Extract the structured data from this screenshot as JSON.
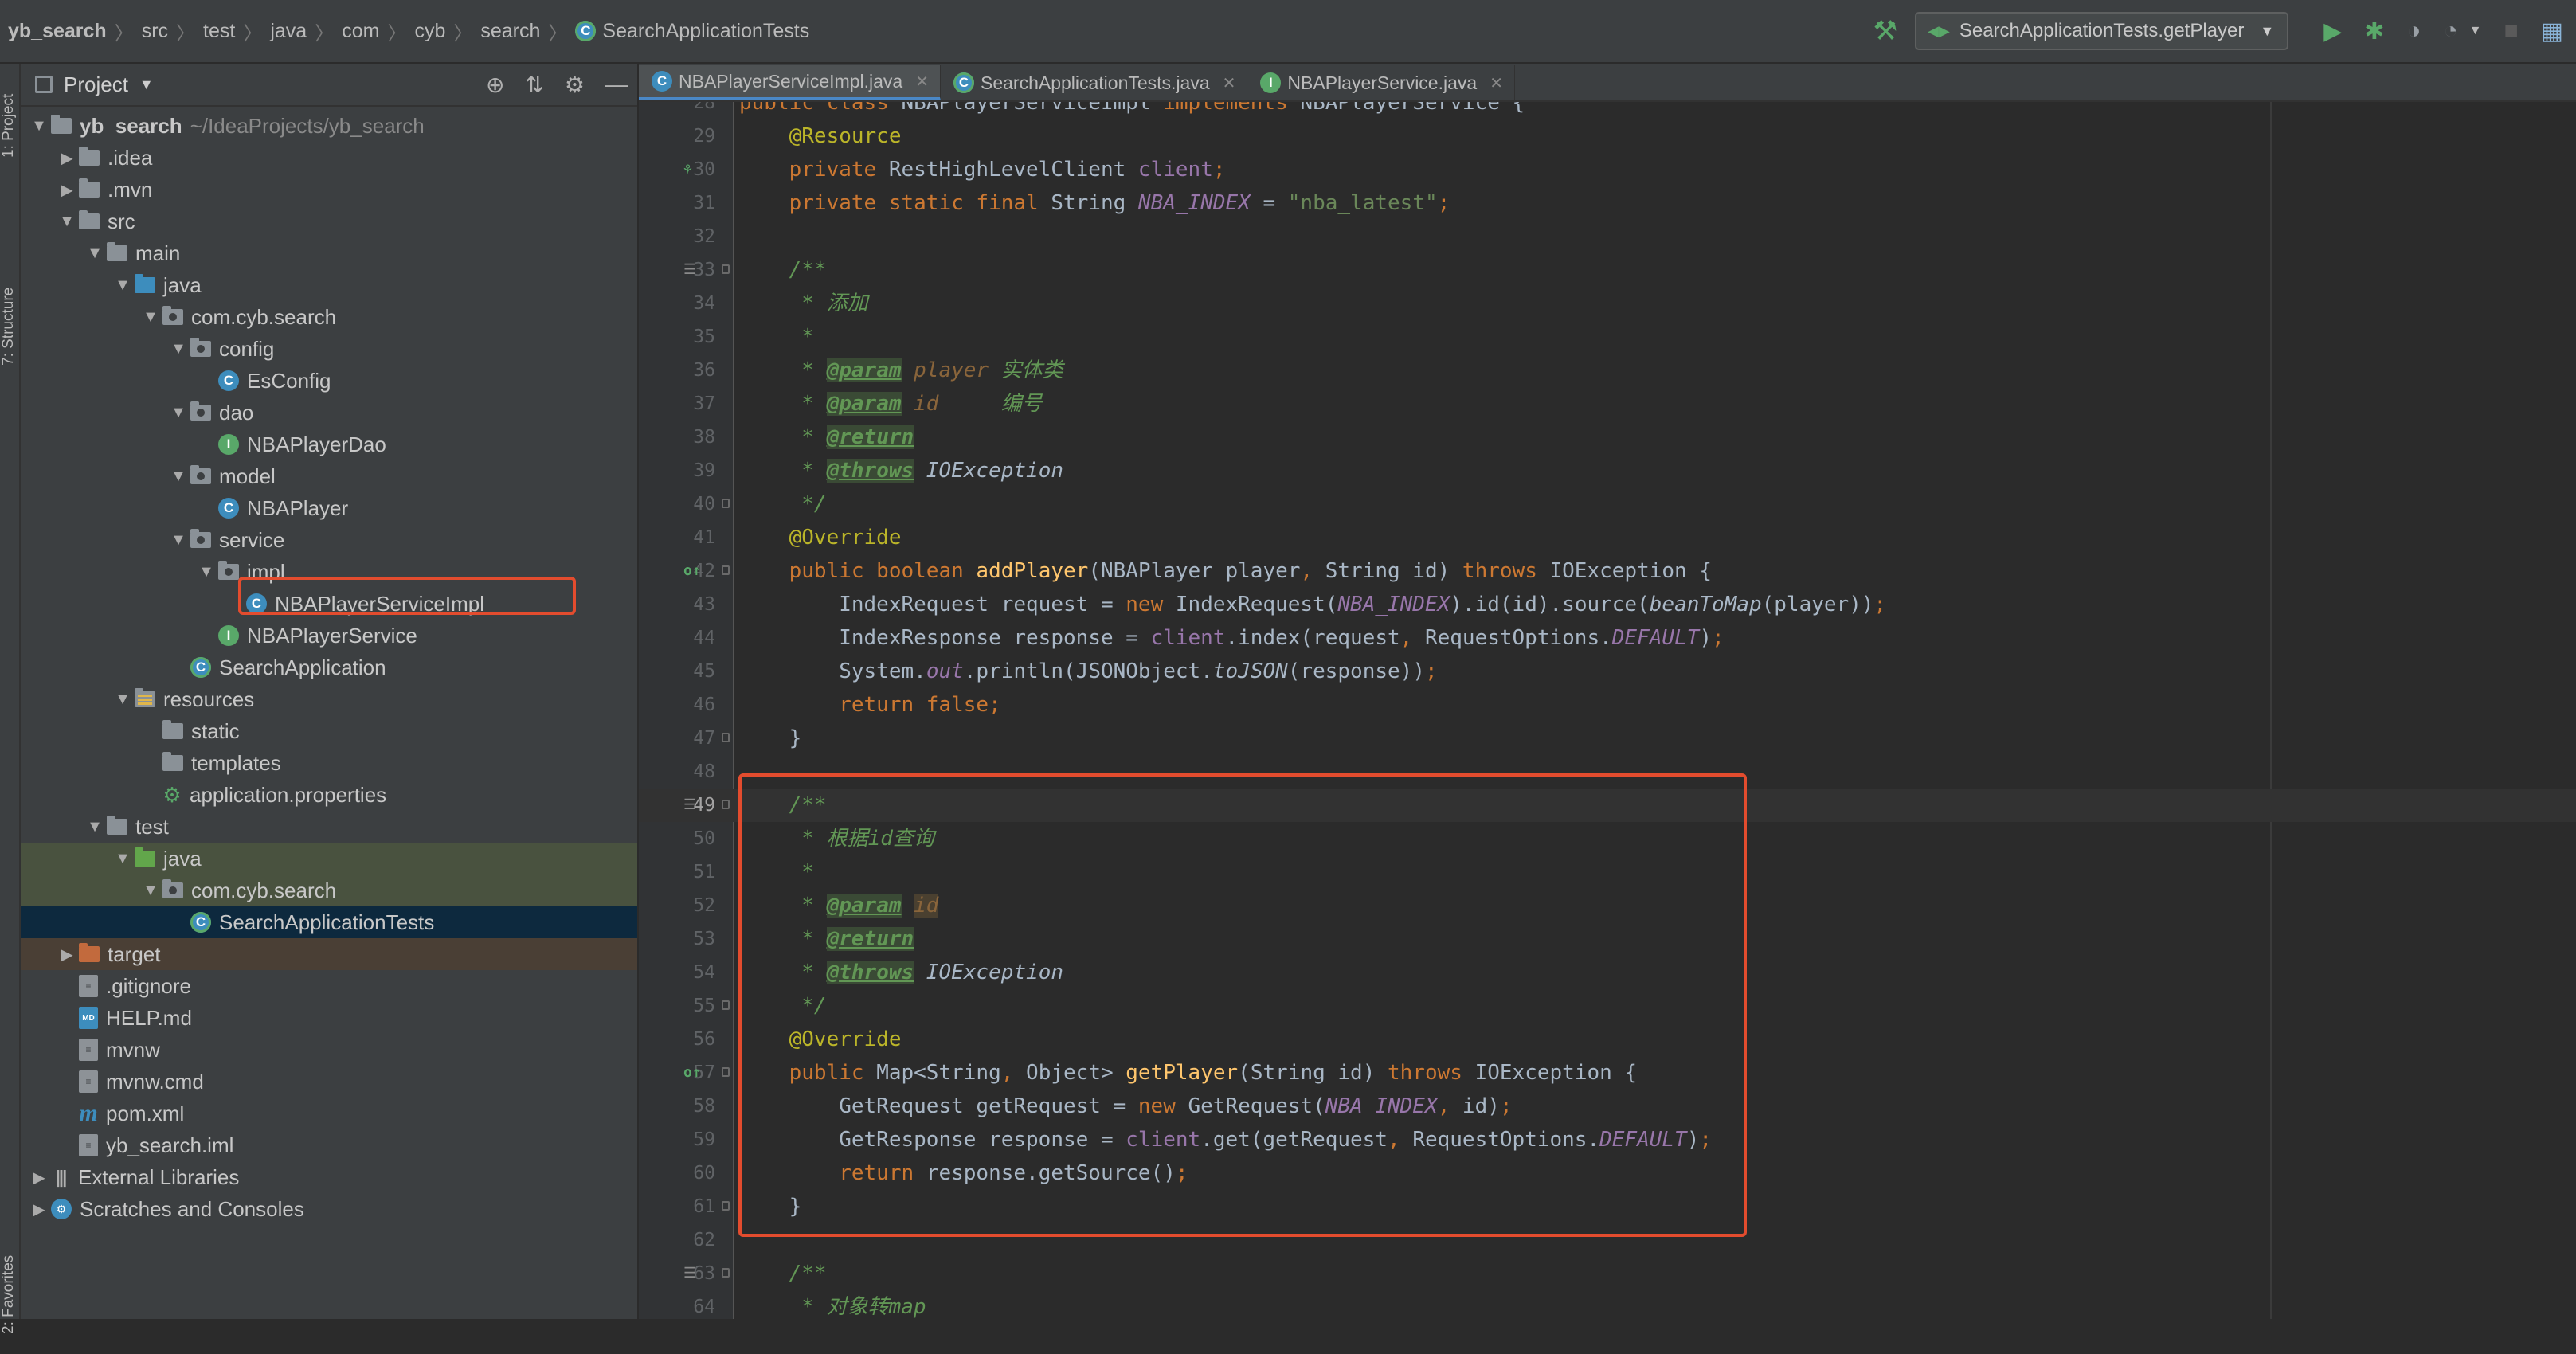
{
  "breadcrumbs": [
    "yb_search",
    "src",
    "test",
    "java",
    "com",
    "cyb",
    "search",
    "SearchApplicationTests"
  ],
  "run_config": "SearchApplicationTests.getPlayer",
  "icons": {
    "build": "hammer-icon",
    "run": "run-icon",
    "debug": "debug-icon",
    "coverage": "coverage-icon",
    "profile": "profile-icon",
    "stop": "stop-icon",
    "structure": "project-structure-icon"
  },
  "left_strip": {
    "project": "1: Project",
    "structure": "7: Structure",
    "favorites": "2: Favorites"
  },
  "project_panel": {
    "title": "Project",
    "tree": [
      {
        "label": "yb_search",
        "hint": "~/IdeaProjects/yb_search",
        "depth": 0,
        "arrow": "down",
        "icon": "folder"
      },
      {
        "label": ".idea",
        "depth": 1,
        "arrow": "right",
        "icon": "folder"
      },
      {
        "label": ".mvn",
        "depth": 1,
        "arrow": "right",
        "icon": "folder"
      },
      {
        "label": "src",
        "depth": 1,
        "arrow": "down",
        "icon": "folder"
      },
      {
        "label": "main",
        "depth": 2,
        "arrow": "down",
        "icon": "folder"
      },
      {
        "label": "java",
        "depth": 3,
        "arrow": "down",
        "icon": "folder-blue"
      },
      {
        "label": "com.cyb.search",
        "depth": 4,
        "arrow": "down",
        "icon": "package"
      },
      {
        "label": "config",
        "depth": 5,
        "arrow": "down",
        "icon": "package"
      },
      {
        "label": "EsConfig",
        "depth": 6,
        "icon": "class"
      },
      {
        "label": "dao",
        "depth": 5,
        "arrow": "down",
        "icon": "package"
      },
      {
        "label": "NBAPlayerDao",
        "depth": 6,
        "icon": "interface"
      },
      {
        "label": "model",
        "depth": 5,
        "arrow": "down",
        "icon": "package"
      },
      {
        "label": "NBAPlayer",
        "depth": 6,
        "icon": "class"
      },
      {
        "label": "service",
        "depth": 5,
        "arrow": "down",
        "icon": "package"
      },
      {
        "label": "impl",
        "depth": 6,
        "arrow": "down",
        "icon": "package"
      },
      {
        "label": "NBAPlayerServiceImpl",
        "depth": 7,
        "icon": "class",
        "highlight": true
      },
      {
        "label": "NBAPlayerService",
        "depth": 6,
        "icon": "interface"
      },
      {
        "label": "SearchApplication",
        "depth": 5,
        "icon": "springboot"
      },
      {
        "label": "resources",
        "depth": 3,
        "arrow": "down",
        "icon": "resources"
      },
      {
        "label": "static",
        "depth": 4,
        "icon": "folder"
      },
      {
        "label": "templates",
        "depth": 4,
        "icon": "folder"
      },
      {
        "label": "application.properties",
        "depth": 4,
        "icon": "properties"
      },
      {
        "label": "test",
        "depth": 2,
        "arrow": "down",
        "icon": "folder"
      },
      {
        "label": "java",
        "depth": 3,
        "arrow": "down",
        "icon": "folder-green",
        "bg": "test"
      },
      {
        "label": "com.cyb.search",
        "depth": 4,
        "arrow": "down",
        "icon": "package",
        "bg": "test"
      },
      {
        "label": "SearchApplicationTests",
        "depth": 5,
        "icon": "testclass",
        "bg": "selected"
      },
      {
        "label": "target",
        "depth": 1,
        "arrow": "right",
        "icon": "folder-orange",
        "bg": "excluded"
      },
      {
        "label": ".gitignore",
        "depth": 1,
        "icon": "file"
      },
      {
        "label": "HELP.md",
        "depth": 1,
        "icon": "md"
      },
      {
        "label": "mvnw",
        "depth": 1,
        "icon": "file"
      },
      {
        "label": "mvnw.cmd",
        "depth": 1,
        "icon": "file"
      },
      {
        "label": "pom.xml",
        "depth": 1,
        "icon": "maven"
      },
      {
        "label": "yb_search.iml",
        "depth": 1,
        "icon": "file"
      },
      {
        "label": "External Libraries",
        "depth": 0,
        "arrow": "right",
        "icon": "library"
      },
      {
        "label": "Scratches and Consoles",
        "depth": 0,
        "arrow": "right",
        "icon": "scratches"
      }
    ]
  },
  "tabs": [
    {
      "label": "NBAPlayerServiceImpl.java",
      "icon": "class",
      "active": true
    },
    {
      "label": "SearchApplicationTests.java",
      "icon": "testclass",
      "active": false
    },
    {
      "label": "NBAPlayerService.java",
      "icon": "interface",
      "active": false
    }
  ],
  "code_lines": [
    {
      "n": "28",
      "tokens": [
        [
          "kw",
          "public class "
        ],
        [
          "",
          "NBAPlayerServiceImpl "
        ],
        [
          "kw",
          "implements "
        ],
        [
          "",
          "NBAPlayerService {"
        ]
      ]
    },
    {
      "n": "29",
      "tokens": [
        [
          "ann",
          "    @Resource"
        ]
      ]
    },
    {
      "n": "30",
      "g": "bean",
      "tokens": [
        [
          "kw",
          "    private "
        ],
        [
          "",
          "RestHighLevelClient "
        ],
        [
          "fld",
          "client"
        ],
        [
          "kw",
          ";"
        ]
      ]
    },
    {
      "n": "31",
      "tokens": [
        [
          "kw",
          "    private static final "
        ],
        [
          "",
          "String "
        ],
        [
          "cst",
          "NBA_INDEX"
        ],
        [
          "",
          " = "
        ],
        [
          "str",
          "\"nba_latest\""
        ],
        [
          "kw",
          ";"
        ]
      ]
    },
    {
      "n": "32",
      "tokens": []
    },
    {
      "n": "33",
      "g": "doc",
      "f": true,
      "tokens": [
        [
          "cm",
          "    /**"
        ]
      ]
    },
    {
      "n": "34",
      "tokens": [
        [
          "cm",
          "     * 添加"
        ]
      ]
    },
    {
      "n": "35",
      "tokens": [
        [
          "cm",
          "     *"
        ]
      ]
    },
    {
      "n": "36",
      "tokens": [
        [
          "cm",
          "     * "
        ],
        [
          "tag",
          "@param"
        ],
        [
          "pn",
          " player"
        ],
        [
          "cm",
          " 实体类"
        ]
      ]
    },
    {
      "n": "37",
      "tokens": [
        [
          "cm",
          "     * "
        ],
        [
          "tag",
          "@param"
        ],
        [
          "pn",
          " id"
        ],
        [
          "cm",
          "     编号"
        ]
      ]
    },
    {
      "n": "38",
      "tokens": [
        [
          "cm",
          "     * "
        ],
        [
          "tag",
          "@return"
        ]
      ]
    },
    {
      "n": "39",
      "tokens": [
        [
          "cm",
          "     * "
        ],
        [
          "tag",
          "@throws"
        ],
        [
          "cmt-plain",
          " IOException"
        ]
      ]
    },
    {
      "n": "40",
      "f": true,
      "tokens": [
        [
          "cm",
          "     */"
        ]
      ]
    },
    {
      "n": "41",
      "tokens": [
        [
          "ann",
          "    @Override"
        ]
      ]
    },
    {
      "n": "42",
      "g": "ov",
      "f": true,
      "tokens": [
        [
          "kw",
          "    public boolean "
        ],
        [
          "mth",
          "addPlayer"
        ],
        [
          "",
          "(NBAPlayer player"
        ],
        [
          "kw",
          ", "
        ],
        [
          "",
          "String id) "
        ],
        [
          "kw",
          "throws "
        ],
        [
          "",
          "IOException {"
        ]
      ]
    },
    {
      "n": "43",
      "tokens": [
        [
          "",
          "        IndexRequest request = "
        ],
        [
          "kw",
          "new "
        ],
        [
          "",
          "IndexRequest("
        ],
        [
          "cst",
          "NBA_INDEX"
        ],
        [
          "",
          ").id(id).source("
        ],
        [
          "stc",
          "beanToMap"
        ],
        [
          "",
          "(player))"
        ],
        [
          "kw",
          ";"
        ]
      ]
    },
    {
      "n": "44",
      "tokens": [
        [
          "",
          "        IndexResponse response = "
        ],
        [
          "fld",
          "client"
        ],
        [
          "",
          ".index(request"
        ],
        [
          "kw",
          ", "
        ],
        [
          "",
          "RequestOptions."
        ],
        [
          "cst",
          "DEFAULT"
        ],
        [
          "",
          ")"
        ],
        [
          "kw",
          ";"
        ]
      ]
    },
    {
      "n": "45",
      "tokens": [
        [
          "",
          "        System."
        ],
        [
          "cst",
          "out"
        ],
        [
          "",
          ".println(JSONObject."
        ],
        [
          "stc",
          "toJSON"
        ],
        [
          "",
          "(response))"
        ],
        [
          "kw",
          ";"
        ]
      ]
    },
    {
      "n": "46",
      "tokens": [
        [
          "kw",
          "        return false;"
        ]
      ]
    },
    {
      "n": "47",
      "f": true,
      "tokens": [
        [
          "",
          "    }"
        ]
      ]
    },
    {
      "n": "48",
      "tokens": []
    },
    {
      "n": "49",
      "g": "doc",
      "f": true,
      "cur": true,
      "tokens": [
        [
          "cm",
          "    /**"
        ]
      ]
    },
    {
      "n": "50",
      "tokens": [
        [
          "cm",
          "     * 根据id查询"
        ]
      ]
    },
    {
      "n": "51",
      "tokens": [
        [
          "cm",
          "     *"
        ]
      ]
    },
    {
      "n": "52",
      "tokens": [
        [
          "cm",
          "     * "
        ],
        [
          "tag",
          "@param"
        ],
        [
          "cm",
          " "
        ],
        [
          "pnh",
          "id"
        ]
      ]
    },
    {
      "n": "53",
      "tokens": [
        [
          "cm",
          "     * "
        ],
        [
          "tag",
          "@return"
        ]
      ]
    },
    {
      "n": "54",
      "tokens": [
        [
          "cm",
          "     * "
        ],
        [
          "tag",
          "@throws"
        ],
        [
          "cmt-plain",
          " IOException"
        ]
      ]
    },
    {
      "n": "55",
      "f": true,
      "tokens": [
        [
          "cm",
          "     */"
        ]
      ]
    },
    {
      "n": "56",
      "tokens": [
        [
          "ann",
          "    @Override"
        ]
      ]
    },
    {
      "n": "57",
      "g": "ov",
      "f": true,
      "tokens": [
        [
          "kw",
          "    public "
        ],
        [
          "",
          "Map<String"
        ],
        [
          "kw",
          ", "
        ],
        [
          "",
          "Object> "
        ],
        [
          "mth",
          "getPlayer"
        ],
        [
          "",
          "(String id) "
        ],
        [
          "kw",
          "throws "
        ],
        [
          "",
          "IOException {"
        ]
      ]
    },
    {
      "n": "58",
      "tokens": [
        [
          "",
          "        GetRequest getRequest = "
        ],
        [
          "kw",
          "new "
        ],
        [
          "",
          "GetRequest("
        ],
        [
          "cst",
          "NBA_INDEX"
        ],
        [
          "kw",
          ", "
        ],
        [
          "",
          "id)"
        ],
        [
          "kw",
          ";"
        ]
      ]
    },
    {
      "n": "59",
      "tokens": [
        [
          "",
          "        GetResponse response = "
        ],
        [
          "fld",
          "client"
        ],
        [
          "",
          ".get(getRequest"
        ],
        [
          "kw",
          ", "
        ],
        [
          "",
          "RequestOptions."
        ],
        [
          "cst",
          "DEFAULT"
        ],
        [
          "",
          ")"
        ],
        [
          "kw",
          ";"
        ]
      ]
    },
    {
      "n": "60",
      "tokens": [
        [
          "kw",
          "        return "
        ],
        [
          "",
          "response.getSource()"
        ],
        [
          "kw",
          ";"
        ]
      ]
    },
    {
      "n": "61",
      "f": true,
      "tokens": [
        [
          "",
          "    }"
        ]
      ]
    },
    {
      "n": "62",
      "tokens": []
    },
    {
      "n": "63",
      "g": "doc",
      "f": true,
      "tokens": [
        [
          "cm",
          "    /**"
        ]
      ]
    },
    {
      "n": "64",
      "tokens": [
        [
          "cm",
          "     * 对象转map"
        ]
      ]
    }
  ],
  "colors": {
    "highlight_box": "#e34c2e",
    "accent_tab": "#4a88c7"
  }
}
